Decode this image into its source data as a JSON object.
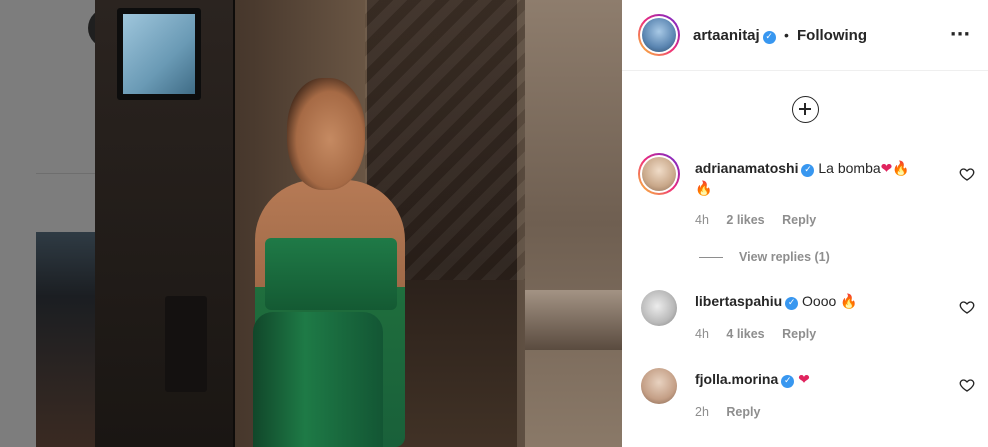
{
  "post": {
    "owner": {
      "username": "artaanitaj",
      "verified": true,
      "follow_status": "Following"
    },
    "header": {
      "separator": "•",
      "more_icon": "more-horizontal-icon"
    },
    "load_more_icon": "plus-circle-icon"
  },
  "comments": [
    {
      "username": "adrianamatoshi",
      "verified": true,
      "text": "La bomba",
      "emojis": [
        "❤",
        "🔥",
        "🔥"
      ],
      "time": "4h",
      "likes": "2 likes",
      "reply": "Reply",
      "view_replies": "View replies (1)"
    },
    {
      "username": "libertaspahiu",
      "verified": true,
      "text": "Oooo",
      "emojis": [
        "🔥"
      ],
      "time": "4h",
      "likes": "4 likes",
      "reply": "Reply"
    },
    {
      "username": "fjolla.morina",
      "verified": true,
      "text": "",
      "emojis": [
        "❤"
      ],
      "time": "2h",
      "reply": "Reply"
    }
  ],
  "icons": {
    "verified": "verified-badge-icon",
    "like": "heart-outline-icon"
  },
  "colors": {
    "verified": "#3897f0",
    "muted": "#8e8e8e",
    "text": "#262626",
    "heart": "#e0245e",
    "fire": "#f4900c"
  }
}
